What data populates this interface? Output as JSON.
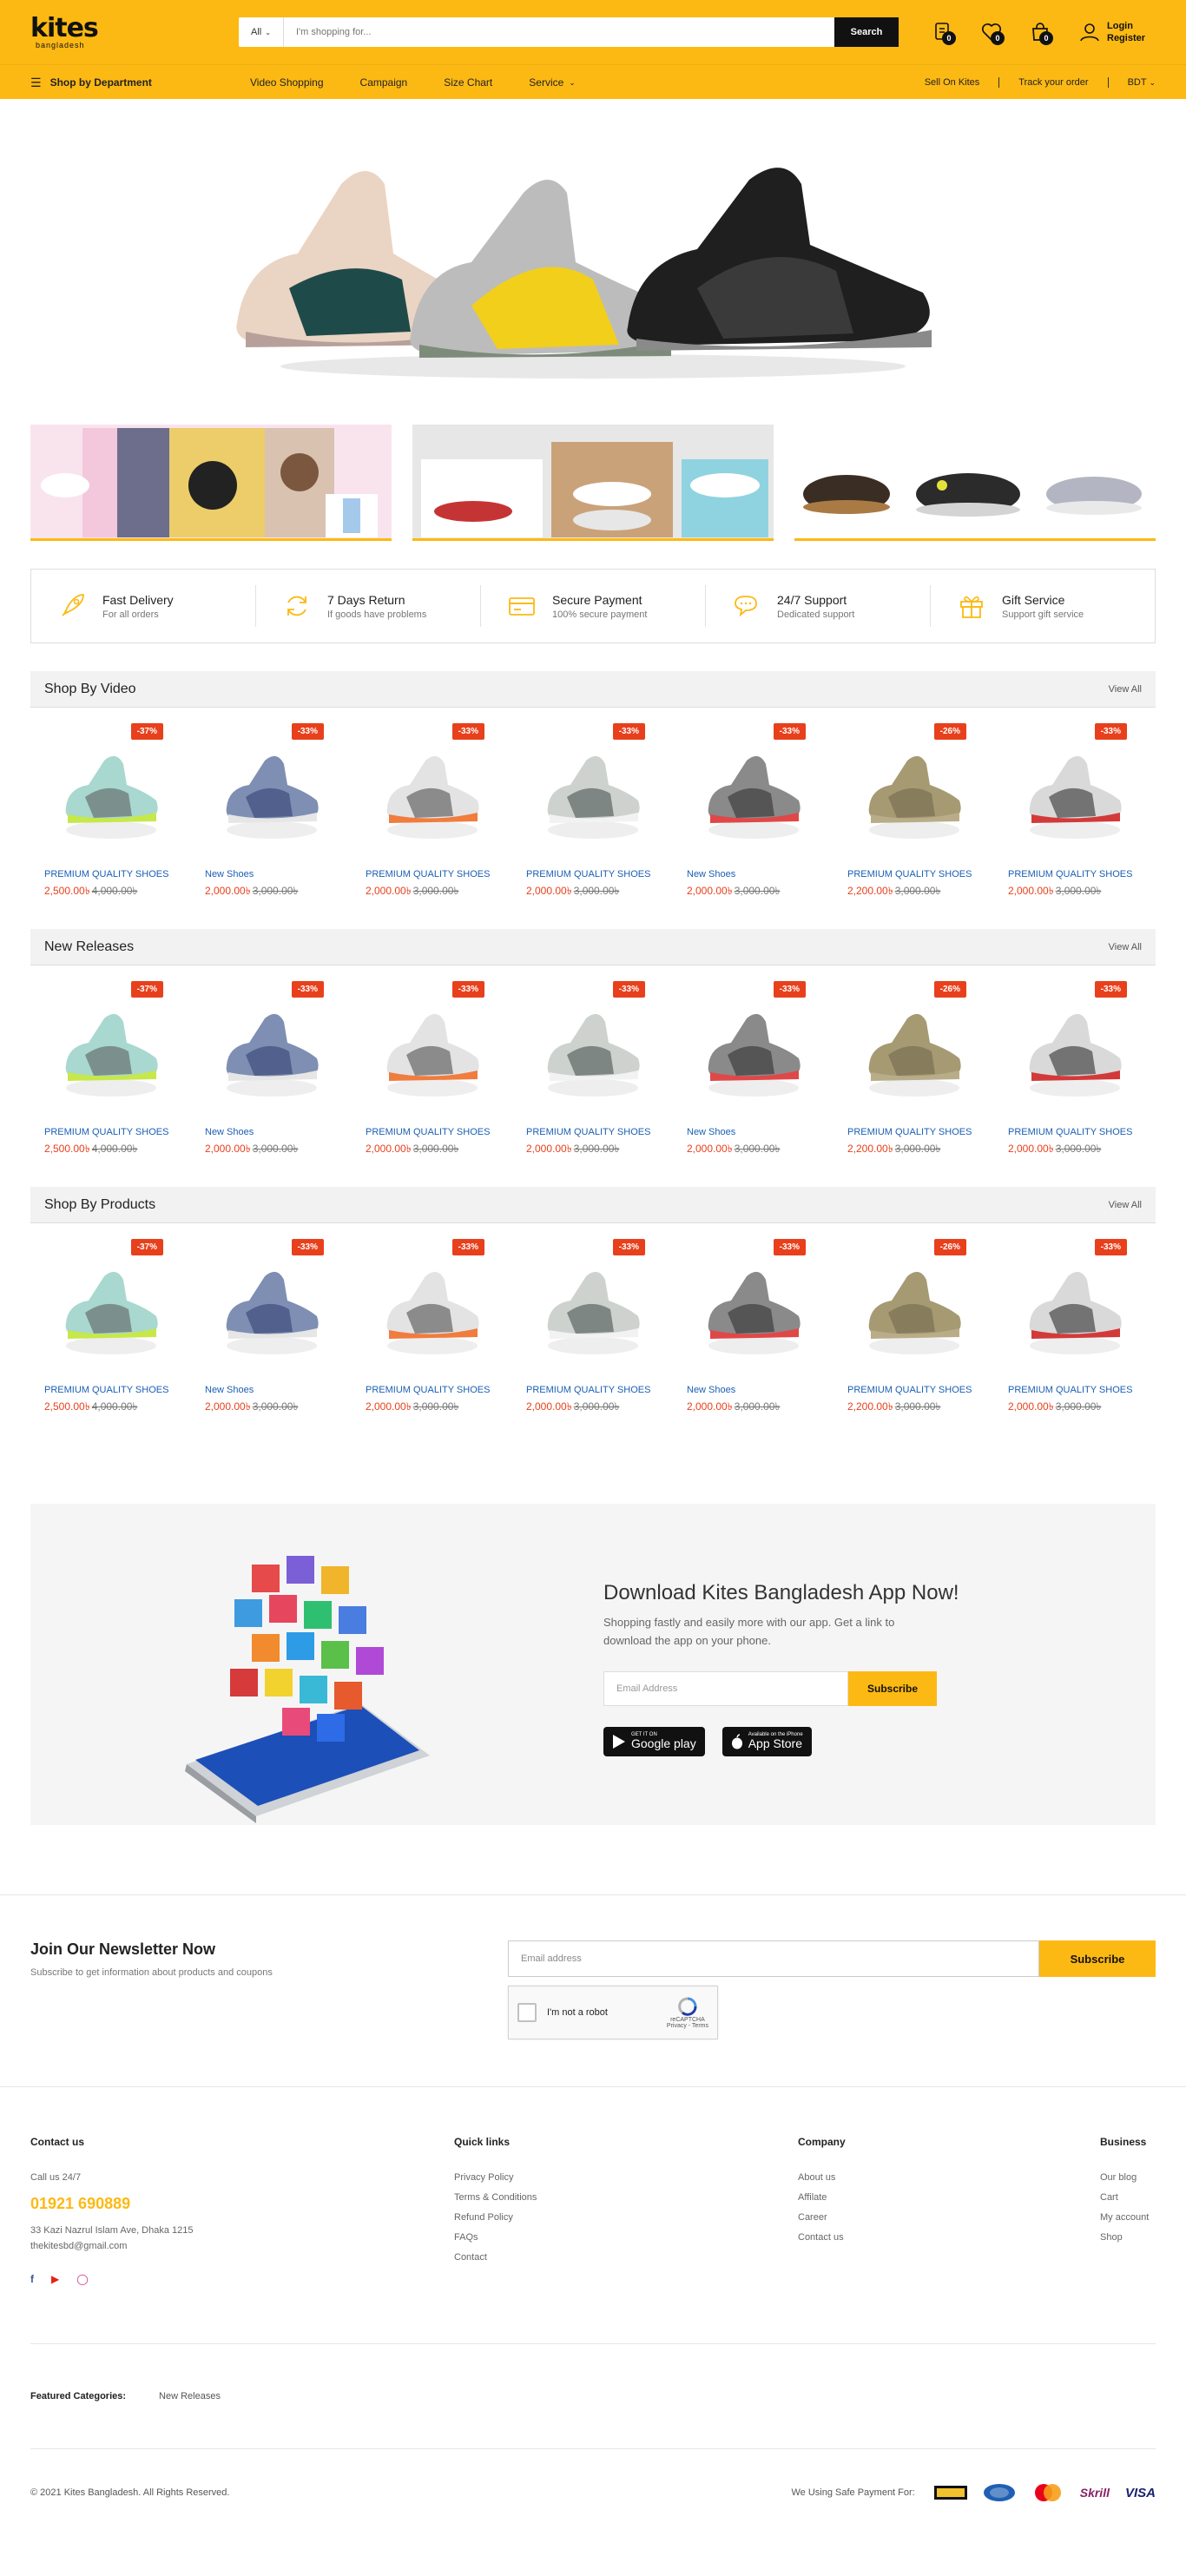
{
  "header": {
    "logo_main": "kites",
    "logo_sub": "bangladesh",
    "search_category": "All",
    "search_placeholder": "I'm shopping for...",
    "search_button": "Search",
    "compare_count": "0",
    "wishlist_count": "0",
    "cart_count": "0",
    "login": "Login",
    "register": "Register"
  },
  "nav": {
    "department": "Shop by Department",
    "items": [
      "Video Shopping",
      "Campaign",
      "Size Chart",
      "Service"
    ],
    "sell": "Sell On Kites",
    "track": "Track your order",
    "currency": "BDT"
  },
  "features": [
    {
      "title": "Fast Delivery",
      "sub": "For all orders",
      "icon": "rocket-icon"
    },
    {
      "title": "7 Days Return",
      "sub": "If goods have problems",
      "icon": "refresh-icon"
    },
    {
      "title": "Secure Payment",
      "sub": "100% secure payment",
      "icon": "credit-card-icon"
    },
    {
      "title": "24/7 Support",
      "sub": "Dedicated support",
      "icon": "chat-icon"
    },
    {
      "title": "Gift Service",
      "sub": "Support gift service",
      "icon": "gift-icon"
    }
  ],
  "sections": [
    {
      "title": "Shop By Video",
      "view_all": "View All"
    },
    {
      "title": "New Releases",
      "view_all": "View All"
    },
    {
      "title": "Shop By Products",
      "view_all": "View All"
    }
  ],
  "products": [
    {
      "discount": "-37%",
      "name": "PREMIUM QUALITY SHOES",
      "price": "2,500.00৳",
      "old": "4,000.00৳",
      "shoe": {
        "body": "#a8d8cf",
        "accent": "#c6e84a",
        "dark": "#555"
      }
    },
    {
      "discount": "-33%",
      "name": "New Shoes",
      "price": "2,000.00৳",
      "old": "3,000.00৳",
      "shoe": {
        "body": "#7e8fb3",
        "accent": "#e6e6e6",
        "dark": "#2c3a6b"
      }
    },
    {
      "discount": "-33%",
      "name": "PREMIUM QUALITY SHOES",
      "price": "2,000.00৳",
      "old": "3,000.00৳",
      "shoe": {
        "body": "#e3e3e3",
        "accent": "#f07c3e",
        "dark": "#444"
      }
    },
    {
      "discount": "-33%",
      "name": "PREMIUM QUALITY SHOES",
      "price": "2,000.00৳",
      "old": "3,000.00৳",
      "shoe": {
        "body": "#cdd2cf",
        "accent": "#f2f2f2",
        "dark": "#3d4743"
      }
    },
    {
      "discount": "-33%",
      "name": "New Shoes",
      "price": "2,000.00৳",
      "old": "3,000.00৳",
      "shoe": {
        "body": "#8a8a8a",
        "accent": "#e04848",
        "dark": "#2a2a2a"
      }
    },
    {
      "discount": "-26%",
      "name": "PREMIUM QUALITY SHOES",
      "price": "2,200.00৳",
      "old": "3,000.00৳",
      "shoe": {
        "body": "#a69a73",
        "accent": "#b8ad88",
        "dark": "#6e6448"
      }
    },
    {
      "discount": "-33%",
      "name": "PREMIUM QUALITY SHOES",
      "price": "2,000.00৳",
      "old": "3,000.00৳",
      "shoe": {
        "body": "#d9d9d9",
        "accent": "#d23a3a",
        "dark": "#1f1f1f"
      }
    }
  ],
  "app": {
    "title": "Download Kites Bangladesh App Now!",
    "text": "Shopping fastly and easily more with our app. Get a link to download the app on your phone.",
    "email_placeholder": "Email Address",
    "subscribe": "Subscribe",
    "google_small": "GET IT ON",
    "google_big": "Google play",
    "apple_small": "Available on the iPhone",
    "apple_big": "App Store"
  },
  "newsletter": {
    "title": "Join Our Newsletter Now",
    "sub": "Subscribe to get information about products and coupons",
    "email_placeholder": "Email address",
    "subscribe": "Subscribe",
    "captcha_label": "I'm not a robot",
    "captcha_brand": "reCAPTCHA",
    "captcha_links": "Privacy - Terms"
  },
  "footer": {
    "contact_title": "Contact us",
    "call": "Call us 24/7",
    "phone": "01921 690889",
    "address": "33 Kazi Nazrul Islam Ave, Dhaka 1215",
    "email": "thekitesbd@gmail.com",
    "quick_title": "Quick links",
    "quick_links": [
      "Privacy Policy",
      "Terms & Conditions",
      "Refund Policy",
      "FAQs",
      "Contact"
    ],
    "company_title": "Company",
    "company_links": [
      "About us",
      "Affilate",
      "Career",
      "Contact us"
    ],
    "business_title": "Business",
    "business_links": [
      "Our blog",
      "Cart",
      "My account",
      "Shop"
    ],
    "featured_label": "Featured Categories:",
    "featured_item": "New Releases",
    "copyright": "© 2021 Kites Bangladesh. All Rights Reserved.",
    "pay_label": "We Using Safe Payment For:",
    "pay_methods": [
      "Skrill",
      "VISA"
    ]
  },
  "colors": {
    "accent": "#fdb913",
    "sale": "#e8401c",
    "link": "#1a5fb4"
  }
}
